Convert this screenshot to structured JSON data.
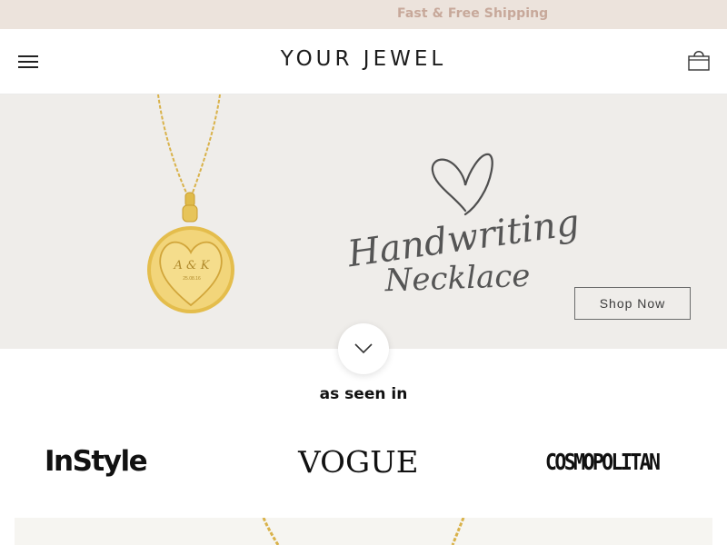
{
  "announcement": {
    "text": "Fast & Free Shipping"
  },
  "header": {
    "logo": "YOUR JEWEL"
  },
  "hero": {
    "title_line1": "Handwriting",
    "title_line2": "Necklace",
    "engraving_initials": "A & K",
    "engraving_date": "25.08.16",
    "cta_label": "Shop Now"
  },
  "press": {
    "heading": "as seen in",
    "logos": [
      "InStyle",
      "VOGUE",
      "COSMOPOLITAN"
    ]
  },
  "colors": {
    "announcement_bg": "#ece3dc",
    "announcement_text": "#c7a89a",
    "hero_bg": "#efedea",
    "gold": "#e7c24c"
  },
  "icons": {
    "menu": "hamburger-menu-icon",
    "cart": "shopping-bag-icon",
    "scroll": "chevron-down-icon"
  }
}
